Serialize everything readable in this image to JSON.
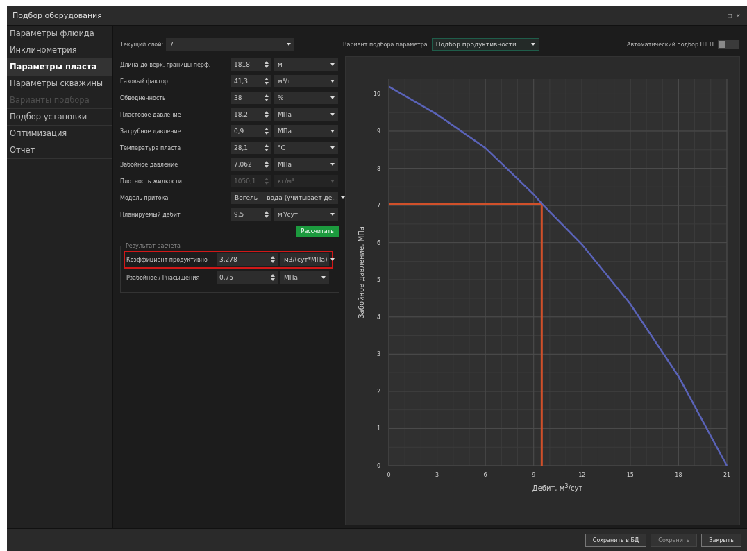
{
  "window": {
    "title": "Подбор оборудования",
    "controls": [
      "_",
      "□",
      "×"
    ]
  },
  "sidebar": {
    "items": [
      {
        "label": "Параметры флюида",
        "selected": false,
        "disabled": false
      },
      {
        "label": "Инклинометрия",
        "selected": false,
        "disabled": false
      },
      {
        "label": "Параметры пласта",
        "selected": true,
        "disabled": false
      },
      {
        "label": "Параметры скважины",
        "selected": false,
        "disabled": false
      },
      {
        "label": "Варианты подбора",
        "selected": false,
        "disabled": true
      },
      {
        "label": "Подбор установки",
        "selected": false,
        "disabled": false
      },
      {
        "label": "Оптимизация",
        "selected": false,
        "disabled": false
      },
      {
        "label": "Отчет",
        "selected": false,
        "disabled": false
      }
    ]
  },
  "layer": {
    "label": "Текущий слой:",
    "value": "7"
  },
  "variant": {
    "label": "Вариант подбора параметра",
    "value": "Подбор продуктивности"
  },
  "auto_pick": {
    "label": "Автоматический подбор ШГН",
    "on": false
  },
  "params": [
    {
      "kind": "number",
      "label": "Длина до верх. границы перф.",
      "value": "1818",
      "unit": "м",
      "disabled": false
    },
    {
      "kind": "number",
      "label": "Газовый фактор",
      "value": "41,3",
      "unit": "м³/т",
      "disabled": false
    },
    {
      "kind": "number",
      "label": "Обводненность",
      "value": "38",
      "unit": "%",
      "disabled": false
    },
    {
      "kind": "number",
      "label": "Пластовое давление",
      "value": "18,2",
      "unit": "МПа",
      "disabled": false
    },
    {
      "kind": "number",
      "label": "Затрубное давление",
      "value": "0,9",
      "unit": "МПа",
      "disabled": false
    },
    {
      "kind": "number",
      "label": "Температура пласта",
      "value": "28,1",
      "unit": "°С",
      "disabled": false
    },
    {
      "kind": "number",
      "label": "Забойное давление",
      "value": "7,062",
      "unit": "МПа",
      "disabled": false
    },
    {
      "kind": "number",
      "label": "Плотность жидкости",
      "value": "1050,1",
      "unit": "кг/м³",
      "disabled": true
    },
    {
      "kind": "select",
      "label": "Модель притока",
      "value": "Вогель + вода (учитывает де...",
      "disabled": false
    },
    {
      "kind": "number",
      "label": "Планируемый дебит",
      "value": "9,5",
      "unit": "м³/сут",
      "disabled": false
    }
  ],
  "calculate_button": "Рассчитать",
  "results": {
    "title": "Результат расчета",
    "rows": [
      {
        "label": "Коэффициент продуктивно",
        "value": "3,278",
        "unit": "м3/(сут*МПа)",
        "selected": true
      },
      {
        "label": "Рзабойное / Рнасыщения",
        "value": "0,75",
        "unit": "МПа",
        "selected": false
      }
    ]
  },
  "chart": {
    "chart_data": {
      "type": "line",
      "xlabel": "Дебит, м$^{3}$/сут",
      "ylabel": "Забойное давление, МПа",
      "x": [
        0,
        3,
        6,
        9,
        9.5,
        12,
        15,
        18,
        21
      ],
      "series": [
        {
          "color": "#5a63b8",
          "values": [
            10.2,
            9.45,
            8.55,
            7.3,
            7.05,
            5.95,
            4.35,
            2.4,
            0
          ]
        }
      ],
      "xlim": [
        0,
        21
      ],
      "ylim": [
        0,
        10.4
      ],
      "xticks": [
        0,
        3,
        6,
        9,
        12,
        15,
        18,
        21
      ],
      "yticks": [
        0,
        1,
        2,
        3,
        4,
        5,
        6,
        7,
        8,
        9,
        10
      ],
      "grid": true,
      "ref_lines": [
        {
          "axis": "x",
          "value": 9.5,
          "color": "#d0502a"
        },
        {
          "axis": "y",
          "value": 7.05,
          "color": "#d0502a"
        }
      ]
    }
  },
  "buttons": [
    {
      "label": "Сохранить в БД",
      "disabled": false
    },
    {
      "label": "Сохранить",
      "disabled": true
    },
    {
      "label": "Закрыть",
      "disabled": false
    }
  ]
}
